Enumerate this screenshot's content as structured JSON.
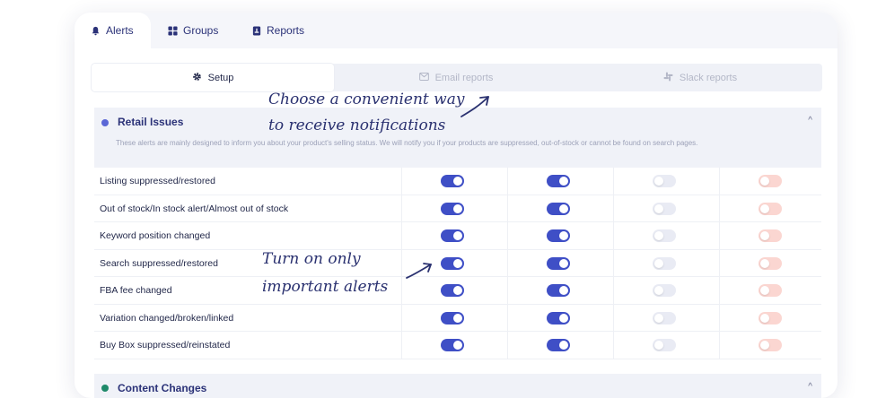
{
  "nav": {
    "tabs": [
      {
        "label": "Alerts",
        "icon": "bell-icon"
      },
      {
        "label": "Groups",
        "icon": "grid-icon"
      },
      {
        "label": "Reports",
        "icon": "report-icon"
      }
    ]
  },
  "subtabs": [
    {
      "label": "Setup",
      "icon": "gear-icon"
    },
    {
      "label": "Email reports",
      "icon": "mail-icon"
    },
    {
      "label": "Slack reports",
      "icon": "slack-icon"
    }
  ],
  "annotations": {
    "top_line1": "Choose a convenient way",
    "top_line2": "to receive notifications",
    "mid_line1": "Turn on only",
    "mid_line2": "important alerts"
  },
  "section": {
    "title": "Retail Issues",
    "description": "These alerts are mainly designed to inform you about your product's selling status. We will notify you if your products are suppressed, out-of-stock or cannot be found on search pages.",
    "caret": "^"
  },
  "rows": [
    {
      "label": "Listing suppressed/restored"
    },
    {
      "label": "Out of stock/In stock alert/Almost out of stock"
    },
    {
      "label": "Keyword position changed"
    },
    {
      "label": "Search suppressed/restored"
    },
    {
      "label": "FBA fee changed"
    },
    {
      "label": "Variation changed/broken/linked"
    },
    {
      "label": "Buy Box suppressed/reinstated"
    }
  ],
  "toggle_states": [
    "on",
    "on",
    "off",
    "off"
  ],
  "section2": {
    "title": "Content Changes",
    "caret": "^"
  },
  "colors": {
    "accent": "#3f4fc6",
    "off_blue": "#e9ebf4",
    "off_red": "#fbd6d1",
    "title": "#2b3278"
  }
}
